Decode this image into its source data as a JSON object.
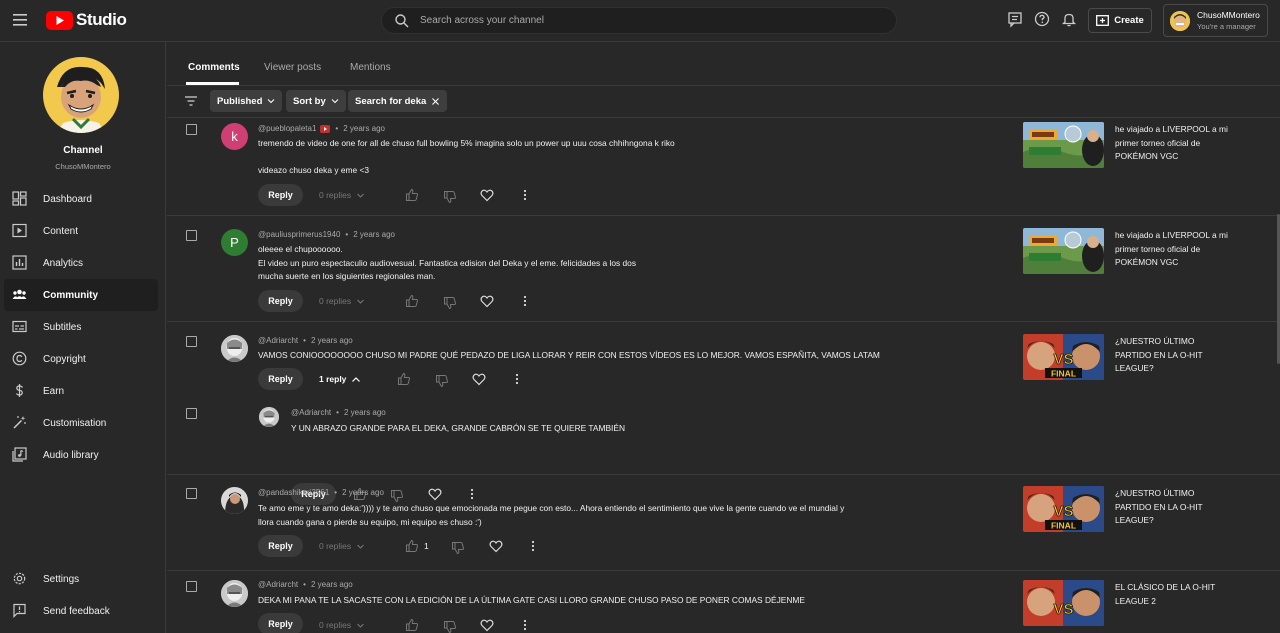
{
  "app": {
    "logo_text": "Studio"
  },
  "search": {
    "placeholder": "Search across your channel"
  },
  "header": {
    "create_label": "Create",
    "account_name": "ChusoMMontero",
    "account_role": "You're a manager"
  },
  "sidebar": {
    "channel_label": "Channel",
    "channel_name": "ChusoMMontero",
    "items": [
      {
        "label": "Dashboard",
        "icon": "dashboard-icon"
      },
      {
        "label": "Content",
        "icon": "content-icon"
      },
      {
        "label": "Analytics",
        "icon": "analytics-icon"
      },
      {
        "label": "Community",
        "icon": "community-icon",
        "active": true
      },
      {
        "label": "Subtitles",
        "icon": "subtitles-icon"
      },
      {
        "label": "Copyright",
        "icon": "copyright-icon"
      },
      {
        "label": "Earn",
        "icon": "earn-icon"
      },
      {
        "label": "Customisation",
        "icon": "customisation-icon"
      },
      {
        "label": "Audio library",
        "icon": "audio-library-icon"
      }
    ],
    "bottom_items": [
      {
        "label": "Settings",
        "icon": "settings-icon"
      },
      {
        "label": "Send feedback",
        "icon": "feedback-icon"
      }
    ]
  },
  "tabs": [
    {
      "label": "Comments",
      "active": true
    },
    {
      "label": "Viewer posts"
    },
    {
      "label": "Mentions"
    }
  ],
  "filters": {
    "published": "Published",
    "sort": "Sort by",
    "search_chip": "Search for deka"
  },
  "colors": {
    "accent": "#ff0000",
    "background": "#282828",
    "chip": "#3e3e3e"
  },
  "comments": [
    {
      "author": "@pueblopaleta1",
      "time": "2 years ago",
      "text": "tremendo de video de one for all  de chuso full bowling 5% imagina solo un power up uuu cosa chhihngona k riko\n\nvideazo chuso deka y eme <3",
      "avatar_letter": "k",
      "reply_label": "Reply",
      "replies": "0 replies",
      "video_title": "he viajado a LIVERPOOL a mi primer torneo oficial de POKÉMON VGC"
    },
    {
      "author": "@pauliusprimerus1940",
      "time": "2 years ago",
      "text": "oleeee el chupoooooo.\nEl video un puro espectaculio audiovesual. Fantastica edision del Deka y el eme. felicidades a los dos\nmucha suerte en los siguientes regionales man.",
      "avatar_letter": "P",
      "reply_label": "Reply",
      "replies": "0 replies",
      "video_title": "he viajado a LIVERPOOL a mi primer torneo oficial de POKÉMON VGC"
    },
    {
      "author": "@Adriarcht",
      "time": "2 years ago",
      "text": "VAMOS CONIOOOOOOOO CHUSO MI PADRE QUÉ PEDAZO DE LIGA LLORAR Y REIR CON ESTOS VÍDEOS ES LO MEJOR. VAMOS ESPAÑITA, VAMOS LATAM",
      "reply_label": "Reply",
      "replies": "1 reply",
      "video_title": "¿NUESTRO ÚLTIMO PARTIDO EN LA O-HIT LEAGUE?",
      "thumb_text": "FINAL",
      "thumb_vs": "VS"
    },
    {
      "author": "@Adriarcht",
      "time": "2 years ago",
      "text": "Y UN ABRAZO GRANDE PARA EL DEKA, GRANDE CABRÓN SE TE QUIERE TAMBIÉN",
      "reply_label": "Reply"
    },
    {
      "author": "@pandashikari3561",
      "time": "2 years ago",
      "text": "Te amo eme y te amo deka:')))) y te amo chuso que emocionada me pegue con esto... Ahora entiendo el sentimiento que vive la gente cuando ve el mundial y\nllora cuando gana o pierde su equipo, mi equipo es chuso :')",
      "reply_label": "Reply",
      "replies": "0 replies",
      "likes": "1",
      "video_title": "¿NUESTRO ÚLTIMO PARTIDO EN LA O-HIT LEAGUE?",
      "thumb_text": "FINAL",
      "thumb_vs": "VS"
    },
    {
      "author": "@Adriarcht",
      "time": "2 years ago",
      "text": "DEKA MI PANA TE LA SACASTE CON LA EDICIÓN DE LA ÚLTIMA GATE CASI LLORO GRANDE CHUSO PASO DE PONER COMAS DÉJENME",
      "reply_label": "Reply",
      "replies": "0 replies",
      "video_title": "EL CLÁSICO DE LA O-HIT LEAGUE 2",
      "thumb_vs": "VS"
    }
  ]
}
